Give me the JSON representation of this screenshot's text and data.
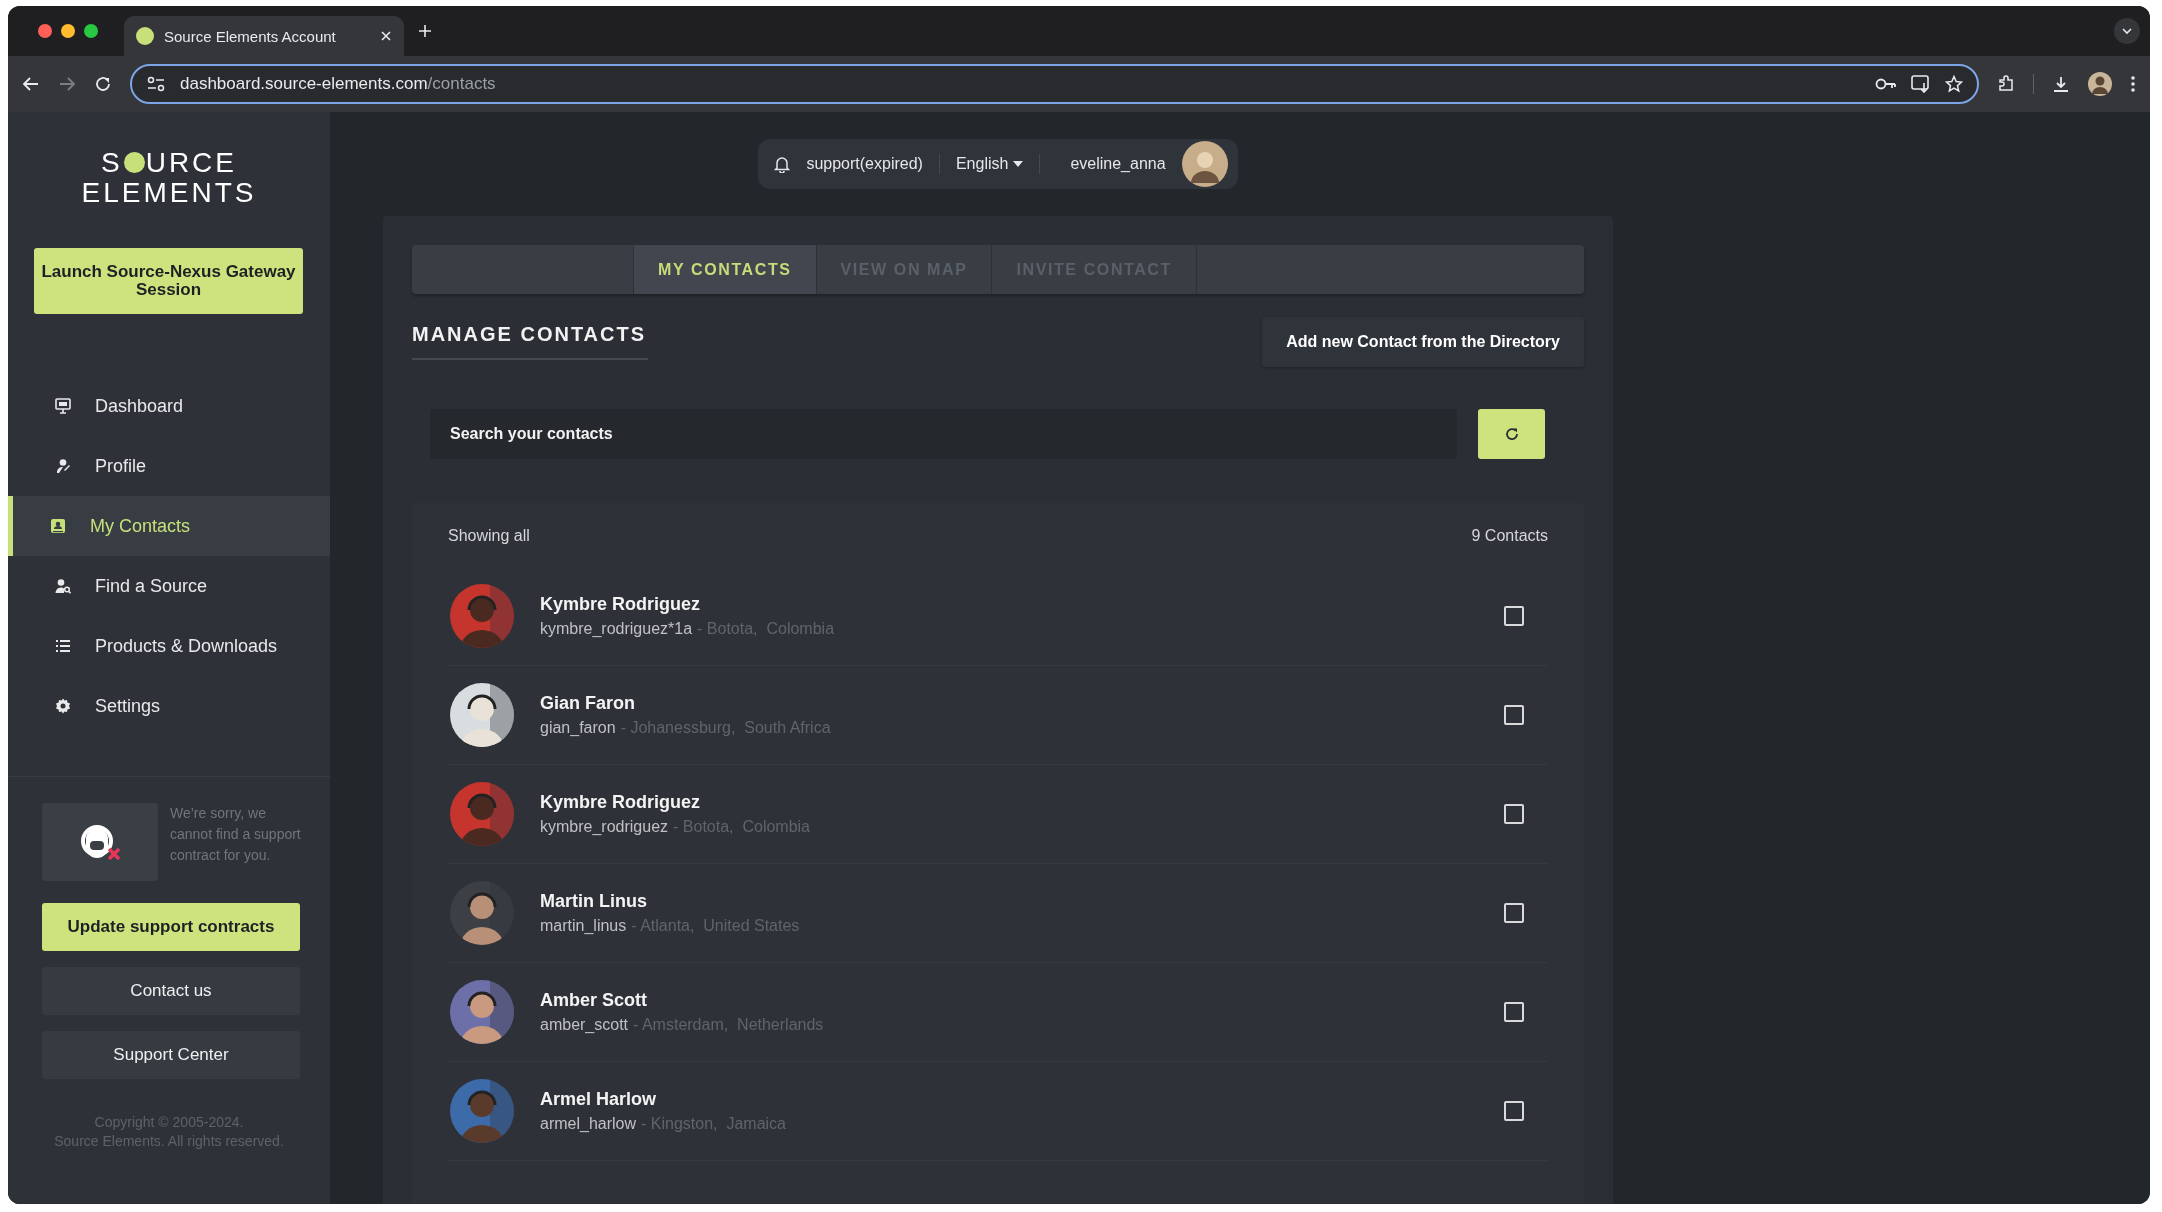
{
  "browser": {
    "tab_title": "Source Elements Account",
    "url_host": "dashboard.source-elements.com",
    "url_path": "/contacts"
  },
  "sidebar": {
    "logo": {
      "line1_start": "S",
      "line1_end": "URCE",
      "line2": "ELEMENTS"
    },
    "launch_button": "Launch Source-Nexus Gateway Session",
    "items": [
      {
        "label": "Dashboard",
        "selected": false
      },
      {
        "label": "Profile",
        "selected": false
      },
      {
        "label": "My Contacts",
        "selected": true
      },
      {
        "label": "Find a Source",
        "selected": false
      },
      {
        "label": "Products & Downloads",
        "selected": false
      },
      {
        "label": "Settings",
        "selected": false
      }
    ],
    "support_message": "We’re sorry, we cannot find a support contract for you.",
    "buttons": [
      {
        "label": "Update support contracts",
        "kind": "primary"
      },
      {
        "label": "Contact us",
        "kind": "secondary"
      },
      {
        "label": "Support Center",
        "kind": "secondary"
      }
    ],
    "copyright": [
      "Copyright © 2005-2024.",
      "Source Elements. All rights reserved."
    ]
  },
  "header": {
    "support": "support(expired)",
    "language": "English",
    "username": "eveline_anna"
  },
  "tabs": [
    {
      "label": "MY CONTACTS",
      "selected": true
    },
    {
      "label": "VIEW ON MAP",
      "selected": false
    },
    {
      "label": "INVITE CONTACT",
      "selected": false
    }
  ],
  "heading": "MANAGE CONTACTS",
  "add_button": "Add new Contact from the Directory",
  "search": {
    "placeholder": "Search your contacts"
  },
  "list": {
    "filter": "Showing all",
    "count": "9 Contacts",
    "contacts": [
      {
        "name": "Kymbre Rodriguez",
        "handle": "kymbre_rodriguez*1a",
        "location": "- Botota,  Colombia",
        "checked": false
      },
      {
        "name": "Gian Faron",
        "handle": "gian_faron",
        "location": "- Johanessburg,  South Africa",
        "checked": false
      },
      {
        "name": "Kymbre Rodriguez",
        "handle": "kymbre_rodriguez",
        "location": "- Botota,  Colombia",
        "checked": false
      },
      {
        "name": "Martin Linus",
        "handle": "martin_linus",
        "location": "- Atlanta,  United States",
        "checked": false
      },
      {
        "name": "Amber Scott",
        "handle": "amber_scott",
        "location": "- Amsterdam,  Netherlands",
        "checked": false
      },
      {
        "name": "Armel Harlow",
        "handle": "armel_harlow",
        "location": "- Kingston,  Jamaica",
        "checked": false
      }
    ]
  }
}
